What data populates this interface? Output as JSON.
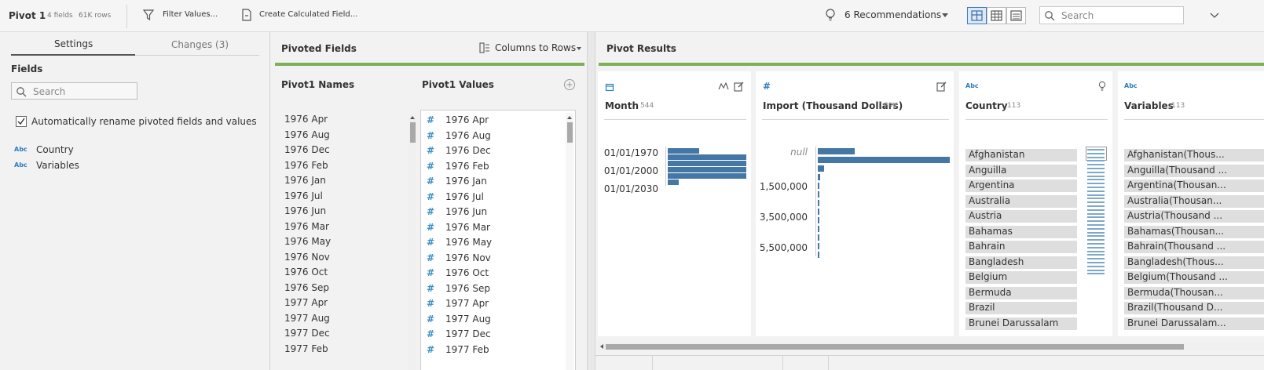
{
  "header": {
    "step_title": "Pivot 1",
    "fields_meta": "4 fields",
    "rows_meta": "61K rows",
    "filter_label": "Filter Values...",
    "calc_label": "Create Calculated Field...",
    "recommendations_label": "6 Recommendations",
    "search_placeholder": "Search"
  },
  "left": {
    "tabs": [
      "Settings",
      "Changes (3)"
    ],
    "active_tab": "Settings",
    "fields_heading": "Fields",
    "search_placeholder": "Search",
    "auto_rename_label": "Automatically rename pivoted fields and values",
    "auto_rename_checked": true,
    "fields": [
      {
        "type": "Abc",
        "name": "Country"
      },
      {
        "type": "Abc",
        "name": "Variables"
      }
    ]
  },
  "middle": {
    "title": "Pivoted Fields",
    "mode_label": "Columns to Rows",
    "names_header": "Pivot1 Names",
    "values_header": "Pivot1 Values",
    "names": [
      "1976 Apr",
      "1976 Aug",
      "1976 Dec",
      "1976 Feb",
      "1976 Jan",
      "1976 Jul",
      "1976 Jun",
      "1976 Mar",
      "1976 May",
      "1976 Nov",
      "1976 Oct",
      "1976 Sep",
      "1977 Apr",
      "1977 Aug",
      "1977 Dec",
      "1977 Feb"
    ],
    "values": [
      "1976 Apr",
      "1976 Aug",
      "1976 Dec",
      "1976 Feb",
      "1976 Jan",
      "1976 Jul",
      "1976 Jun",
      "1976 Mar",
      "1976 May",
      "1976 Nov",
      "1976 Oct",
      "1976 Sep",
      "1977 Apr",
      "1977 Aug",
      "1977 Dec",
      "1977 Feb"
    ]
  },
  "results": {
    "title": "Pivot Results",
    "month": {
      "name": "Month",
      "count": "544",
      "labels": [
        "01/01/1970",
        "01/01/2000",
        "01/01/2030"
      ],
      "bar_fractions": [
        0.4,
        1.0,
        1.0,
        1.0,
        1.0,
        0.14
      ]
    },
    "imports": {
      "name": "Import (Thousand Dollars)",
      "count": "29K",
      "labels": [
        "null",
        "1,500,000",
        "3,500,000",
        "5,500,000"
      ],
      "bar_fractions": [
        0.28,
        1.0,
        0.05,
        0.015,
        0.01,
        0.01,
        0.01,
        0.01,
        0.01,
        0.01,
        0.01,
        0.01,
        0.01
      ]
    },
    "country": {
      "type": "Abc",
      "name": "Country",
      "count": "113",
      "values": [
        "Afghanistan",
        "Anguilla",
        "Argentina",
        "Australia",
        "Austria",
        "Bahamas",
        "Bahrain",
        "Bangladesh",
        "Belgium",
        "Bermuda",
        "Brazil",
        "Brunei Darussalam"
      ]
    },
    "variables": {
      "type": "Abc",
      "name": "Variables",
      "count": "113",
      "values": [
        "Afghanistan(Thous...",
        "Anguilla(Thousand ...",
        "Argentina(Thousan...",
        "Australia(Thousan...",
        "Austria(Thousand ...",
        "Bahamas(Thousan...",
        "Bahrain(Thousand ...",
        "Bangladesh(Thous...",
        "Belgium(Thousand ...",
        "Bermuda(Thousan...",
        "Brazil(Thousand D...",
        "Brunei Darussalam..."
      ]
    }
  },
  "colors": {
    "accent_green": "#7cb15a",
    "bar_blue": "#4477a6",
    "hash_blue": "#3a8ec1"
  }
}
